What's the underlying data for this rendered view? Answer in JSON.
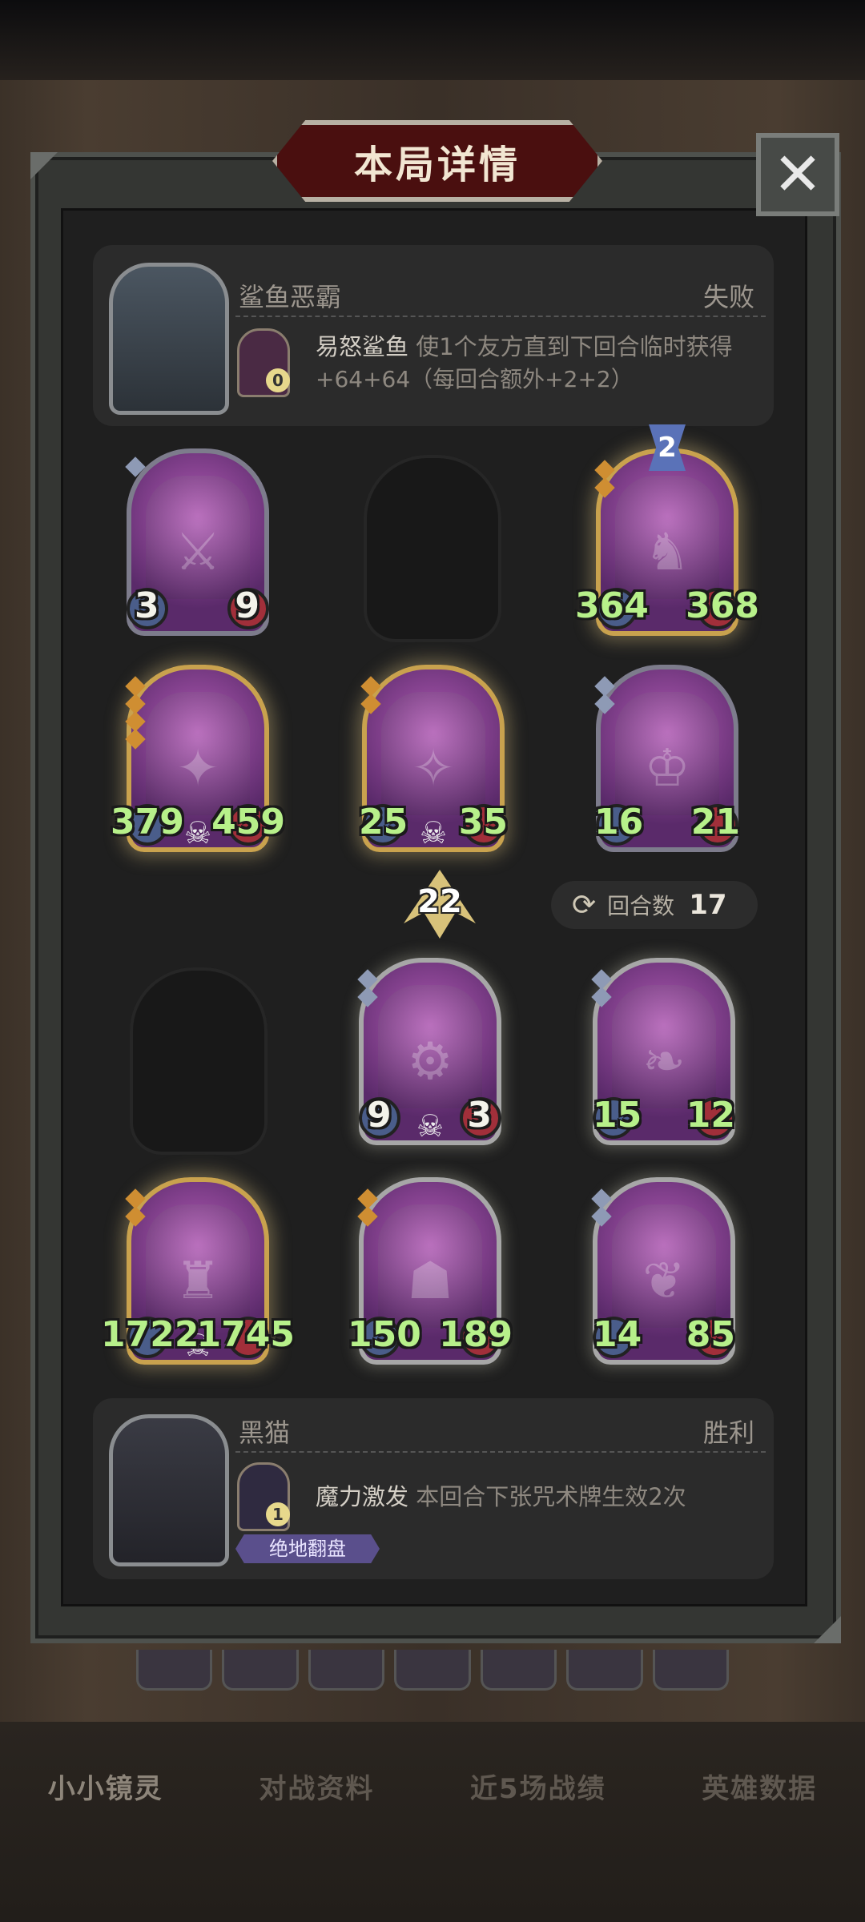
{
  "dialog": {
    "title": "本局详情",
    "close": "✕"
  },
  "opponent": {
    "name": "鲨鱼恶霸",
    "result": "失败",
    "skill_count": "0",
    "skill_name": "易怒鲨鱼",
    "skill_desc_line1": "使1个友方直到下回合临时获得",
    "skill_desc_line2": "+64+64（每回合额外+2+2）"
  },
  "opponent_board": {
    "tier_badge": "2",
    "cards": [
      {
        "atk": "3",
        "hp": "9"
      },
      {
        "atk": "364",
        "hp": "368"
      },
      {
        "atk": "379",
        "hp": "459"
      },
      {
        "atk": "25",
        "hp": "35"
      },
      {
        "atk": "16",
        "hp": "21"
      }
    ]
  },
  "middle": {
    "damage": "22",
    "rounds_label": "回合数",
    "rounds_value": "17"
  },
  "player_board": {
    "cards": [
      {
        "atk": "9",
        "hp": "3"
      },
      {
        "atk": "15",
        "hp": "12"
      },
      {
        "atk": "1722",
        "hp": "1745"
      },
      {
        "atk": "150",
        "hp": "189"
      },
      {
        "atk": "14",
        "hp": "85"
      }
    ]
  },
  "player": {
    "name": "黑猫",
    "result": "胜利",
    "skill_count": "1",
    "skill_name": "魔力激发",
    "skill_desc": "本回合下张咒术牌生效2次",
    "tag": "绝地翻盘"
  },
  "bottom_tabs": [
    "小小镜灵",
    "对战资料",
    "近5场战绩",
    "英雄数据"
  ],
  "icons": {
    "close": "close-icon",
    "refresh": "rounds-icon",
    "skull": "skull-icon",
    "arrow": "damage-arrow-icon"
  },
  "colors": {
    "stat_green": "#b7f08a",
    "title_red": "#4a0f0f",
    "panel": "#343633"
  }
}
